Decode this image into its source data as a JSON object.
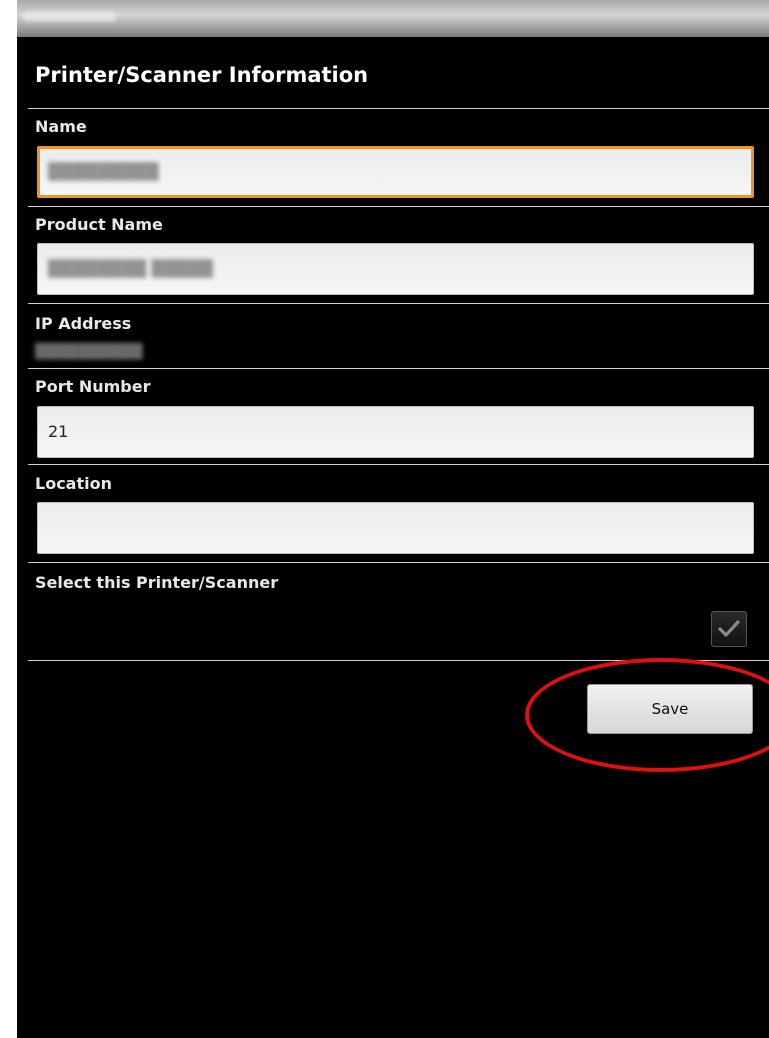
{
  "theme": {
    "background": "#000000",
    "focus_accent": "#f29322",
    "annotation_color": "#e01010"
  },
  "status_bar": {
    "text": "▒▒▒ ▒▒▒▒ ▒"
  },
  "page_title": "Printer/Scanner Information",
  "fields": {
    "name": {
      "label": "Name",
      "value": "▒▒▒▒▒▒▒▒▒",
      "focused": true
    },
    "product_name": {
      "label": "Product Name",
      "value": "▒▒▒▒▒▒▒▒ ▒▒▒▒▒"
    },
    "ip_address": {
      "label": "IP Address",
      "value": "▒▒▒▒▒▒▒▒▒▒"
    },
    "port_number": {
      "label": "Port Number",
      "value": "21"
    },
    "location": {
      "label": "Location",
      "value": ""
    }
  },
  "select_option": {
    "label": "Select this Printer/Scanner",
    "checked": true,
    "icon": "check-icon"
  },
  "save_button": {
    "label": "Save"
  }
}
